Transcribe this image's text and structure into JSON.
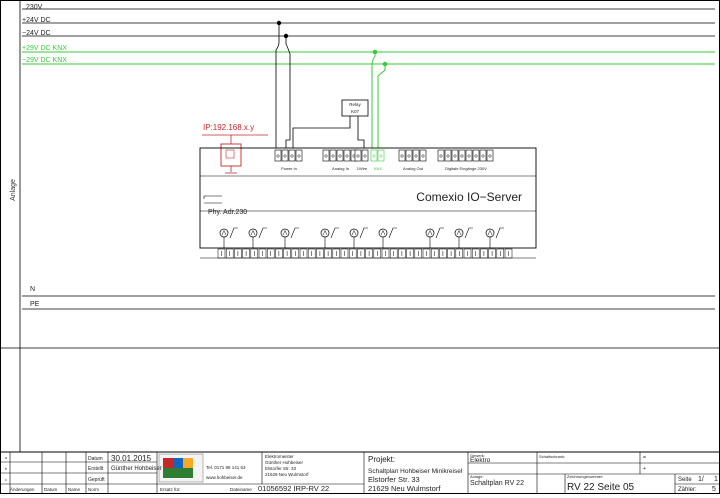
{
  "rails": {
    "v230": "230V",
    "p24": "+24V DC",
    "m24": "−24V DC",
    "p29": "+29V DC KNX",
    "m29": "−29V DC KNX",
    "n": "N",
    "pe": "PE"
  },
  "side_label": "Anlage",
  "ip_label": "IP:192.168.x.y",
  "relay": {
    "top": "Relay",
    "bottom": "K07"
  },
  "server": {
    "title": "Comexio IO−Server",
    "phy": "Phy. Adr.230",
    "groups": [
      "Power In",
      "Analog In",
      "1Wire",
      "KNX",
      "Analog Out",
      "Digitale Eingänge 230V"
    ]
  },
  "accent": {
    "knx_green": "#39c93a",
    "ip_red": "#c62828",
    "line": "#000000"
  },
  "titleblock": {
    "datum_label": "Datum",
    "datum": "30.01.2015",
    "erstellt_label": "Erstellt",
    "erstellt": "Günther Hohbeiser",
    "gepruft_label": "Geprüft",
    "aenderungen": "Änderungen",
    "col_datum": "Datum",
    "col_name": "Name",
    "col_norm": "Norm",
    "ersatz": "Ersatz für:",
    "dateiname_label": "Dateiname",
    "dateiname": "01056592 IRP-RV 22",
    "phone": "Tel. 0171 98 141 63",
    "web": "www.hohbeiser.de",
    "company": [
      "Elektromeister",
      "Günther Hohbeiser",
      "Elstorfer Str. 33",
      "21629 Neu Wulmstorf"
    ],
    "projekt_label": "Projekt:",
    "projekt": [
      "Schaltplan Hohbeiser Minikreisel",
      "Elstorfer Str. 33",
      "21629 Neu Wulmstorf"
    ],
    "gewerk_label": "Gewerk:",
    "gewerk": "Elektro",
    "schaltschrank_label": "Schaltschrank:",
    "anlage_label": "Anlage:",
    "anlage": "Schaltplan RV 22",
    "zeichnungsnummer_label": "Zeichnungsnummer:",
    "zeichnungsnummer": "RV 22 Seite 05",
    "seite_label": "Seite",
    "seite": "1/",
    "zahler_label": "Zähler:",
    "zahler": "5"
  }
}
